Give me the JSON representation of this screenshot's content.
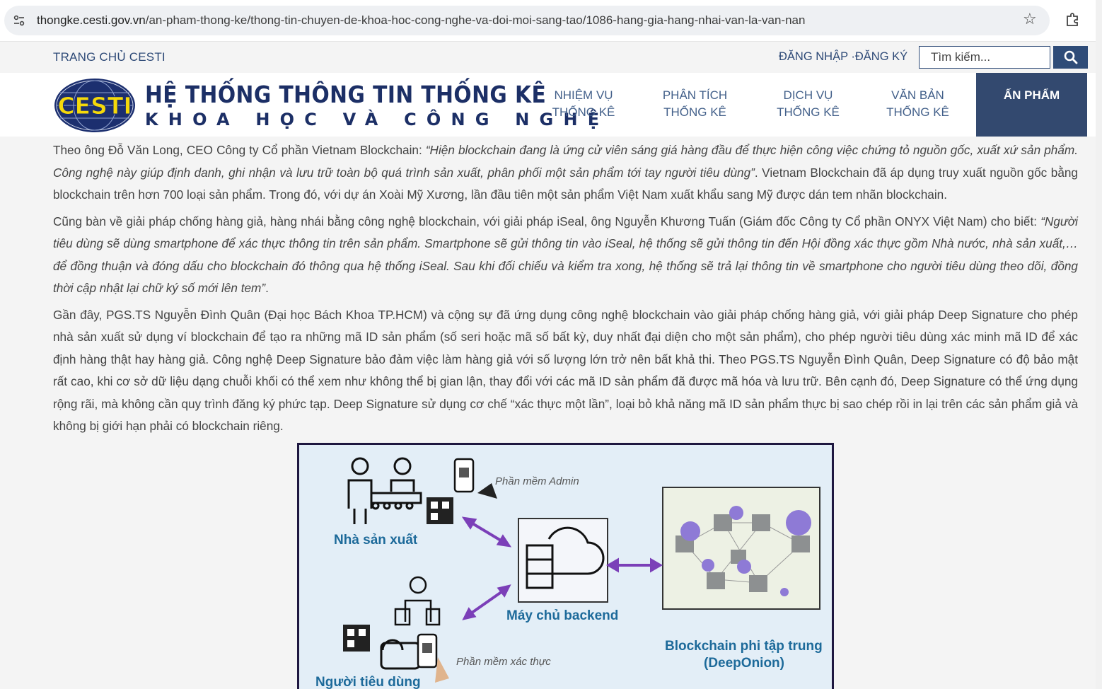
{
  "browser": {
    "url_host": "thongke.cesti.gov.vn",
    "url_path": "/an-pham-thong-ke/thong-tin-chuyen-de-khoa-hoc-cong-nghe-va-doi-moi-sang-tao/1086-hang-gia-hang-nhai-van-la-van-nan"
  },
  "topbar": {
    "home": "TRANG CHỦ CESTI",
    "auth": "ĐĂNG NHẬP ·ĐĂNG KÝ",
    "search_placeholder": "Tìm kiếm..."
  },
  "header": {
    "logo_text": "CESTI",
    "title_line1": "HỆ THỐNG THÔNG TIN THỐNG KÊ",
    "title_line2": "KHOA HỌC VÀ CÔNG NGHỆ",
    "nav": [
      {
        "line1": "NHIỆM VỤ",
        "line2": "THỐNG KÊ"
      },
      {
        "line1": "PHÂN TÍCH",
        "line2": "THỐNG KÊ"
      },
      {
        "line1": "DỊCH VỤ",
        "line2": "THỐNG KÊ"
      },
      {
        "line1": "VĂN BẢN",
        "line2": "THỐNG KÊ"
      },
      {
        "line1": "ẤN PHẨM",
        "line2": ""
      }
    ]
  },
  "article": {
    "p1_lead": "Theo ông Đỗ Văn Long, CEO Công ty Cổ phần Vietnam Blockchain: ",
    "p1_quote": "“Hiện blockchain đang là ứng cử viên sáng giá hàng đầu để thực hiện công việc chứng tỏ nguồn gốc, xuất xứ sản phẩm. Công nghệ này giúp định danh, ghi nhận và lưu trữ toàn bộ quá trình sản xuất, phân phối một sản phẩm tới tay người tiêu dùng”",
    "p1_tail": ". Vietnam Blockchain đã áp dụng truy xuất nguồn gốc bằng blockchain trên hơn 700 loại sản phẩm. Trong đó, với dự án Xoài Mỹ Xương, lần đầu tiên một sản phẩm Việt Nam xuất khẩu sang Mỹ được dán tem nhãn blockchain.",
    "p2_lead": "Cũng bàn về giải pháp chống hàng giả, hàng nhái bằng công nghệ blockchain, với giải pháp iSeal, ông Nguyễn Khương Tuấn (Giám đốc Công ty Cổ phần ONYX Việt Nam) cho biết: ",
    "p2_quote": "“Người tiêu dùng sẽ dùng smartphone để xác thực thông tin trên sản phẩm. Smartphone sẽ gửi thông tin vào iSeal, hệ thống sẽ gửi thông tin đến Hội đồng xác thực gồm Nhà nước, nhà sản xuất,… để đồng thuận và đóng dấu cho blockchain đó thông qua hệ thống iSeal. Sau khi đối chiếu và kiểm tra xong, hệ thống sẽ trả lại thông tin về smartphone cho người tiêu dùng theo dõi, đồng thời cập nhật lại chữ ký số mới lên tem”",
    "p2_tail": ".",
    "p3": "Gần đây, PGS.TS Nguyễn Đình Quân (Đại học Bách Khoa TP.HCM) và cộng sự đã ứng dụng công nghệ blockchain vào giải pháp chống hàng giả, với giải pháp Deep Signature cho phép nhà sản xuất sử dụng ví blockchain để tạo ra những mã ID sản phẩm (số seri hoặc mã số bất kỳ, duy nhất đại diện cho một sản phẩm), cho phép người tiêu dùng xác minh mã ID để xác định hàng thật hay hàng giả. Công nghệ Deep Signature bảo đảm việc làm hàng giả với số lượng lớn trở nên bất khả thi. Theo PGS.TS Nguyễn Đình Quân, Deep Signature có độ bảo mật rất cao, khi cơ sở dữ liệu dạng chuỗi khối có thể xem như không thể bị gian lận, thay đổi với các mã ID sản phẩm đã được mã hóa và lưu trữ. Bên cạnh đó, Deep Signature có thể ứng dụng rộng rãi, mà không cần quy trình đăng ký phức tạp. Deep Signature sử dụng cơ chế “xác thực một lần”, loại bỏ khả năng mã ID sản phẩm thực bị sao chép rồi in lại trên các sản phẩm giả và không bị giới hạn phải có blockchain riêng."
  },
  "figure": {
    "admin_software": "Phần mềm Admin",
    "manufacturer": "Nhà sản xuất",
    "backend": "Máy chủ backend",
    "verify_software": "Phần mềm xác thực",
    "consumer": "Người tiêu dùng",
    "blockchain_line1": "Blockchain phi tập trung",
    "blockchain_line2": "(DeepOnion)"
  },
  "colors": {
    "navy": "#2f4c78",
    "nav_active": "#33496f",
    "link": "#2e4a77",
    "figure_label": "#1d6a9a",
    "arrow": "#7b3fb8"
  }
}
